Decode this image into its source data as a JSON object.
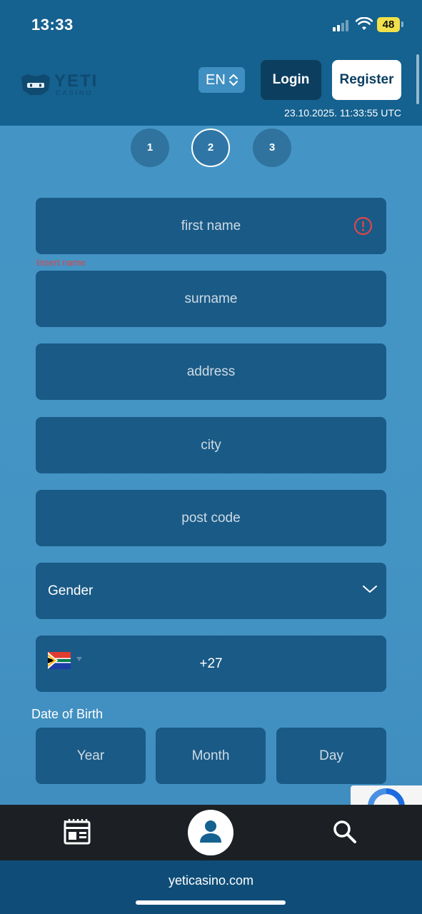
{
  "status_bar": {
    "time": "13:33",
    "battery": "48"
  },
  "header": {
    "logo_text": "YETI",
    "logo_subtext": "CASINO",
    "language": "EN",
    "login_label": "Login",
    "register_label": "Register",
    "timestamp": "23.10.2025. 11:33:55 UTC"
  },
  "steps": [
    {
      "label": "1",
      "active": false
    },
    {
      "label": "2",
      "active": true
    },
    {
      "label": "3",
      "active": false
    }
  ],
  "form": {
    "first_name_placeholder": "first name",
    "first_name_error": "Insert name",
    "surname_placeholder": "surname",
    "address_placeholder": "address",
    "city_placeholder": "city",
    "post_code_placeholder": "post code",
    "gender_label": "Gender",
    "phone_code": "+27",
    "dob_label": "Date of Birth",
    "dob_year": "Year",
    "dob_month": "Month",
    "dob_day": "Day"
  },
  "colors": {
    "header_bg": "#15618f",
    "page_bg": "#4596c6",
    "field_bg": "#1a5a86",
    "error": "#d9444c",
    "login_bg": "#0c3e60",
    "nav_bg": "#1c2024"
  },
  "browser": {
    "url": "yeticasino.com"
  }
}
